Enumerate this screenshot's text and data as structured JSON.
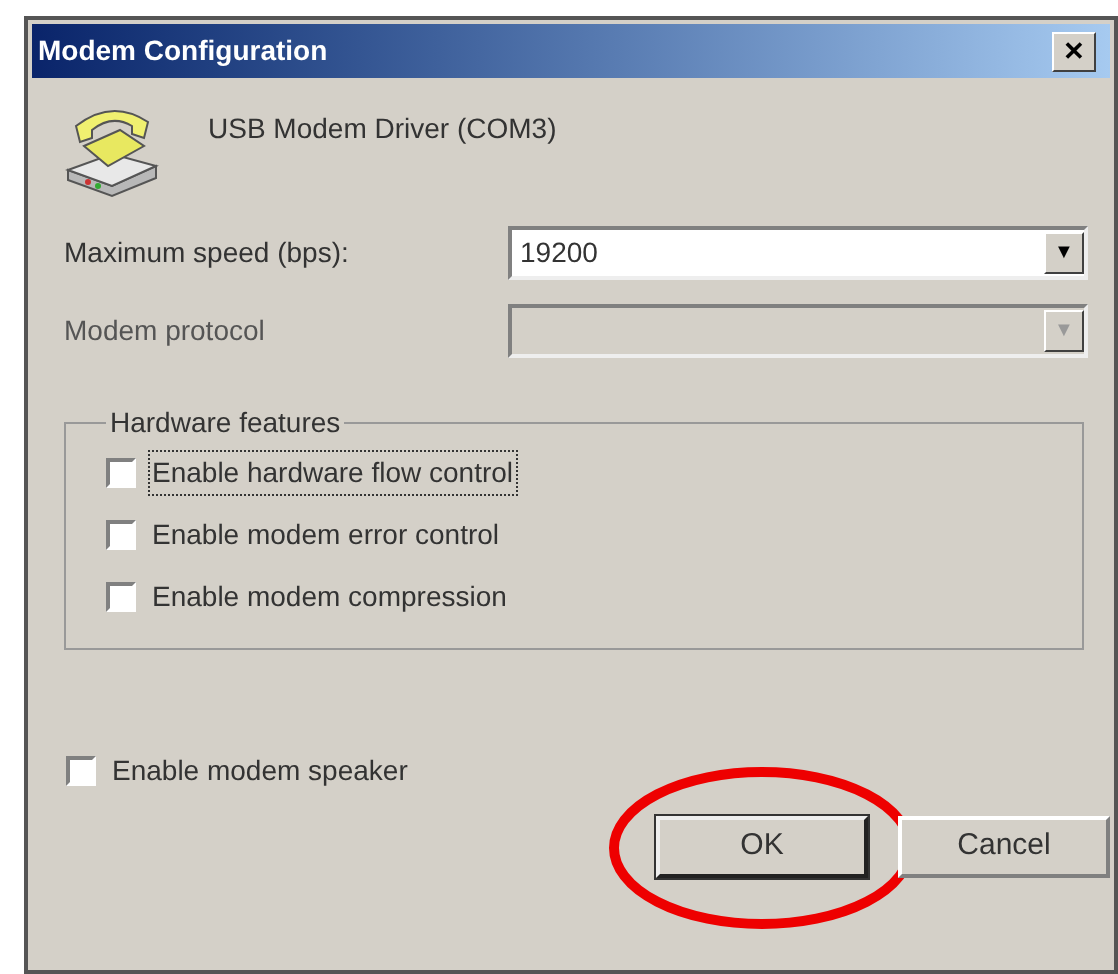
{
  "window": {
    "title": "Modem Configuration",
    "close": "✕"
  },
  "device": {
    "name": "USB Modem Driver (COM3)"
  },
  "fields": [
    {
      "label": "Maximum speed (bps):",
      "value": "19200",
      "disabled": false,
      "arrow": "▼"
    },
    {
      "label": "Modem protocol",
      "disabled": true,
      "arrow": "▼"
    }
  ],
  "group": {
    "title": "Hardware features",
    "options": [
      {
        "label": "Enable hardware flow control",
        "checked": false,
        "focused": true
      },
      {
        "label": "Enable modem error control",
        "checked": false,
        "focused": false
      },
      {
        "label": "Enable modem compression",
        "checked": false,
        "focused": false
      }
    ]
  },
  "speaker": {
    "label": "Enable modem speaker",
    "checked": false
  },
  "buttons": [
    {
      "label": "OK",
      "default": true,
      "circled": true
    },
    {
      "label": "Cancel",
      "default": false,
      "circled": false
    }
  ]
}
